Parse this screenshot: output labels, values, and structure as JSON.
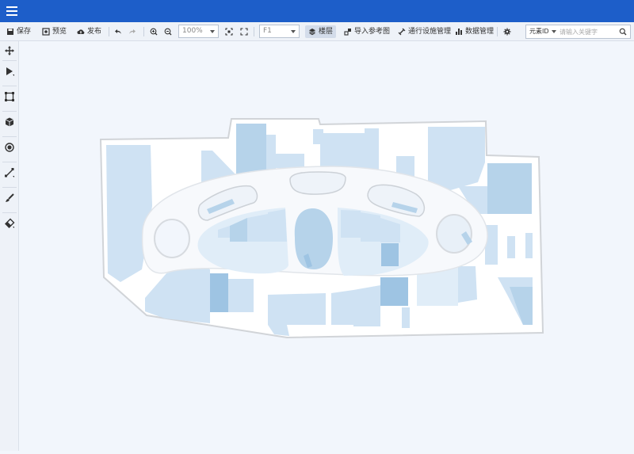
{
  "toolbar": {
    "save": "保存",
    "preview": "预览",
    "publish": "发布",
    "zoom": "100%",
    "floor": "F1",
    "layers": "楼层",
    "import_ref": "导入参考图",
    "pass_facility": "通行设施管理",
    "data_manage": "数据管理"
  },
  "search": {
    "type": "元素ID",
    "placeholder": "请输入关键字"
  },
  "colors": {
    "topbar": "#1d5ec9",
    "shop_light": "#cfe2f3",
    "shop_mid": "#b6d3ea",
    "shop_dark": "#9ec4e3",
    "corridor": "#f7f9fc",
    "outline": "#c9cdd3"
  },
  "icons": {
    "sidebar": [
      "move-icon",
      "select-arrow-icon",
      "polygon-icon",
      "cube-icon",
      "point-icon",
      "line-icon",
      "brush-icon",
      "eraser-icon"
    ]
  }
}
